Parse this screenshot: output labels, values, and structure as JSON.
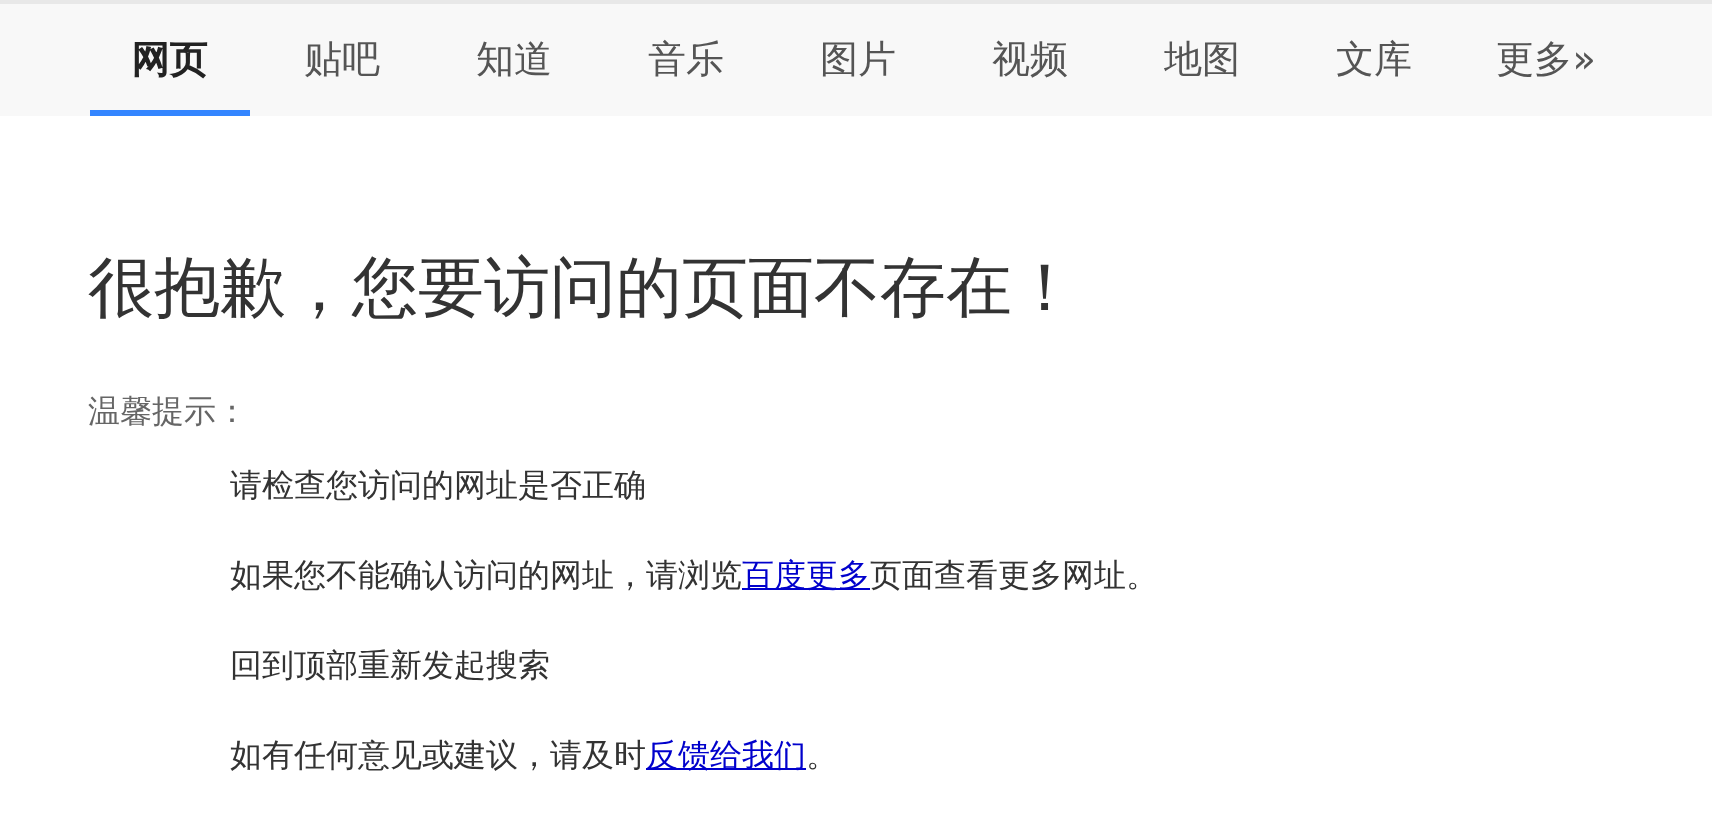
{
  "tabs": [
    {
      "label": "网页",
      "selected": true
    },
    {
      "label": "贴吧",
      "selected": false
    },
    {
      "label": "知道",
      "selected": false
    },
    {
      "label": "音乐",
      "selected": false
    },
    {
      "label": "图片",
      "selected": false
    },
    {
      "label": "视频",
      "selected": false
    },
    {
      "label": "地图",
      "selected": false
    },
    {
      "label": "文库",
      "selected": false
    },
    {
      "label": "更多»",
      "selected": false
    }
  ],
  "heading": "很抱歉，您要访问的页面不存在！",
  "tips_title": "温馨提示：",
  "tips": [
    {
      "before": "请检查您访问的网址是否正确"
    },
    {
      "before": "如果您不能确认访问的网址，请浏览",
      "link": "百度更多",
      "after": "页面查看更多网址。"
    },
    {
      "before": "回到顶部重新发起搜索"
    },
    {
      "before": "如有任何意见或建议，请及时",
      "link": "反馈给我们",
      "after": "。"
    }
  ]
}
